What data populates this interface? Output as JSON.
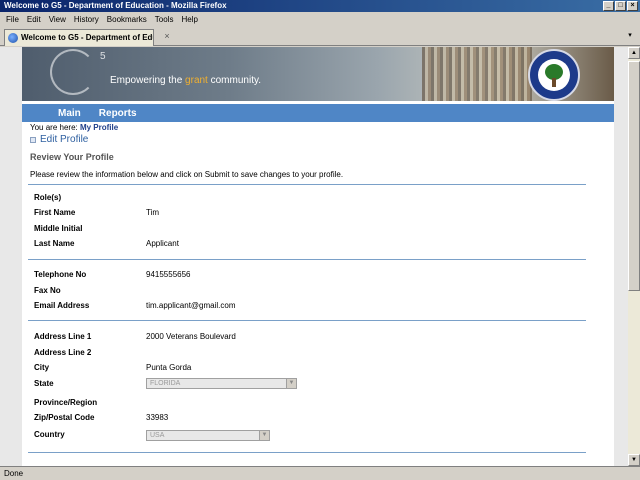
{
  "window": {
    "title": "Welcome to G5 - Department of Education - Mozilla Firefox",
    "min_glyph": "_",
    "max_glyph": "□",
    "close_glyph": "×"
  },
  "menu": {
    "items": [
      "File",
      "Edit",
      "View",
      "History",
      "Bookmarks",
      "Tools",
      "Help"
    ]
  },
  "tab": {
    "label": "Welcome to G5 - Department of Edu...",
    "close_glyph": "×",
    "list_glyph": "▾"
  },
  "banner": {
    "superscript": "5",
    "tagline_pre": "Empowering the ",
    "tagline_highlight": "grant",
    "tagline_post": " community.",
    "colors": {
      "highlight": "#f0b030"
    }
  },
  "nav": {
    "main": "Main",
    "reports": "Reports",
    "color": "#4f86c6"
  },
  "breadcrumb": {
    "prefix": "You are here: ",
    "current": "My Profile"
  },
  "page": {
    "edit_title": "Edit Profile",
    "section_title": "Review Your Profile",
    "instructions": "Please review the information below and click on Submit to save changes to your profile."
  },
  "profile": {
    "roles_label": "Role(s)",
    "first_name_label": "First Name",
    "first_name": "Tim",
    "middle_initial_label": "Middle Initial",
    "last_name_label": "Last Name",
    "last_name": "Applicant",
    "telephone_label": "Telephone No",
    "telephone": "9415555656",
    "fax_label": "Fax No",
    "email_label": "Email Address",
    "email": "tim.applicant@gmail.com",
    "address1_label": "Address Line 1",
    "address1": "2000 Veterans Boulevard",
    "address2_label": "Address Line 2",
    "city_label": "City",
    "city": "Punta Gorda",
    "state_label": "State",
    "state": "FLORIDA",
    "province_label": "Province/Region",
    "zip_label": "Zip/Postal Code",
    "zip": "33983",
    "country_label": "Country",
    "country": "USA"
  },
  "scrollbar": {
    "up": "▲",
    "down": "▼"
  },
  "status": {
    "text": "Done"
  }
}
